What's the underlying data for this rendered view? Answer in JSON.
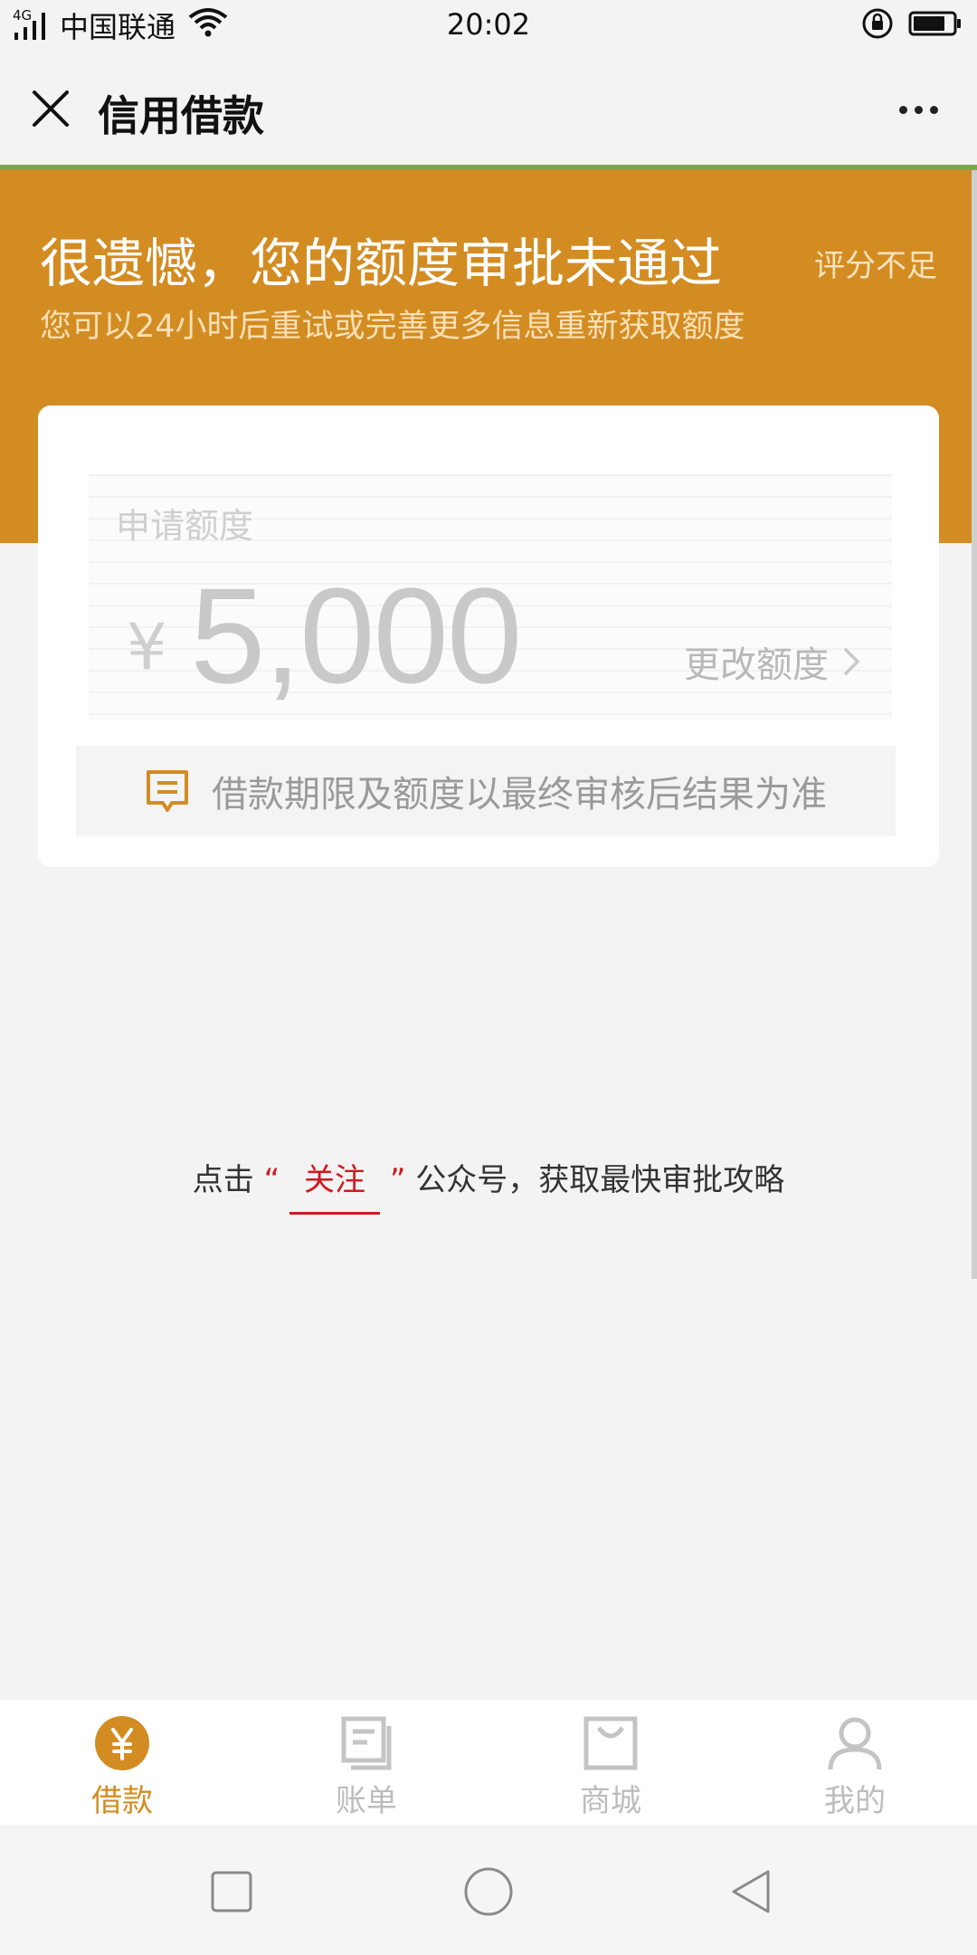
{
  "status_bar": {
    "network": "4G",
    "carrier": "中国联通",
    "time": "20:02"
  },
  "header": {
    "title": "信用借款"
  },
  "banner": {
    "title": "很遗憾，您的额度审批未通过",
    "tag": "评分不足",
    "subtitle": "您可以24小时后重试或完善更多信息重新获取额度"
  },
  "card": {
    "amount_label": "申请额度",
    "currency_symbol": "¥",
    "amount": "5,000",
    "change_label": "更改额度",
    "notice": "借款期限及额度以最终审核后结果为准"
  },
  "follow": {
    "prefix": "点击",
    "open_quote": "“",
    "link": "关注",
    "close_quote": "”",
    "suffix": "公众号，获取最快审批攻略"
  },
  "tabs": [
    {
      "label": "借款",
      "icon": "yen-circle-icon",
      "active": true
    },
    {
      "label": "账单",
      "icon": "bill-icon",
      "active": false
    },
    {
      "label": "商城",
      "icon": "shop-bag-icon",
      "active": false
    },
    {
      "label": "我的",
      "icon": "user-icon",
      "active": false
    }
  ],
  "colors": {
    "brand": "#d38c22",
    "link": "#d0191f",
    "progress": "#7da84a"
  }
}
